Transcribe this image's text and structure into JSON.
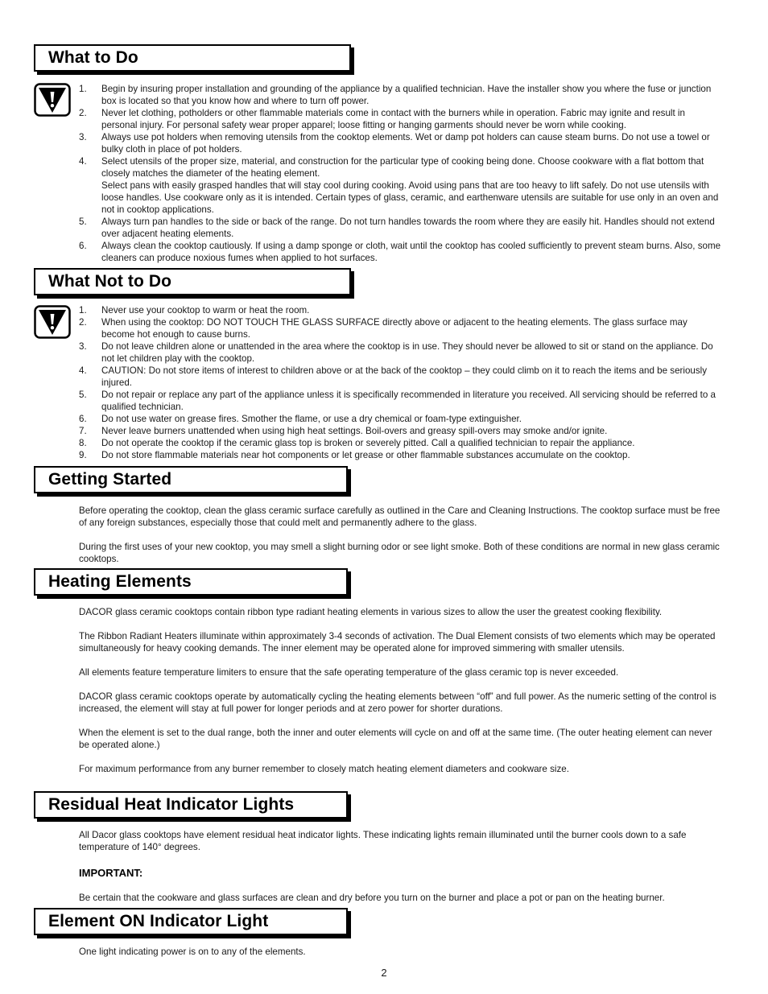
{
  "sections": {
    "what_to_do": {
      "title": "What to Do",
      "icon": "warning-icon",
      "items": [
        {
          "num": "1.",
          "text": "Begin by insuring proper installation and grounding of the appliance by a qualified technician. Have the installer show you where the fuse or junction box is located so that you know how and where to turn off power."
        },
        {
          "num": "2.",
          "text": "Never let clothing, potholders or other flammable materials come in contact with the burners while in operation. Fabric may ignite and result in personal injury. For personal safety wear proper apparel; loose fitting or hanging garments should never be worn while cooking."
        },
        {
          "num": "3.",
          "text": "Always use pot holders when removing utensils from the cooktop elements. Wet or damp pot holders can cause steam burns. Do not use a towel or bulky cloth in place of pot holders."
        },
        {
          "num": "4.",
          "text": "Select utensils of the proper size, material, and construction for the particular type of cooking being done. Choose cookware with a flat bottom that closely matches the diameter of the heating element.",
          "text2": "Select pans with easily grasped handles that will stay cool during cooking. Avoid using pans that are too heavy to lift safely. Do not use utensils with loose handles. Use cookware only as it is intended. Certain types of glass, ceramic, and earthenware utensils are suitable for use only in an oven and not in cooktop applications."
        },
        {
          "num": "5.",
          "text": "Always turn pan handles to the side or back of the range. Do not turn handles towards the room where they are easily hit. Handles should not extend over adjacent heating elements."
        },
        {
          "num": "6.",
          "text": "Always clean the cooktop cautiously. If using a damp sponge or cloth, wait until the cooktop has cooled sufficiently to prevent steam burns. Also, some cleaners can produce noxious fumes when applied to hot surfaces."
        }
      ]
    },
    "what_not_to_do": {
      "title": "What Not to Do",
      "icon": "warning-icon",
      "items": [
        {
          "num": "1.",
          "text": "Never use your cooktop to warm or heat the room."
        },
        {
          "num": "2.",
          "text": "When using the cooktop: DO NOT TOUCH THE GLASS SURFACE directly above or adjacent to the heating elements. The glass surface may become hot enough to cause burns."
        },
        {
          "num": "3.",
          "text": "Do not leave children alone or unattended in the area where the cooktop is in use. They should never be allowed to sit or stand on the appliance. Do not let children play with the cooktop."
        },
        {
          "num": "4.",
          "text": "CAUTION: Do not store items of interest to children above or at the back of the cooktop – they could climb on it to reach the items and be seriously injured."
        },
        {
          "num": "5.",
          "text": "Do not repair or replace any part of the appliance unless it is specifically recommended in literature you received. All servicing should be referred to a qualified technician."
        },
        {
          "num": "6.",
          "text": "Do not use water on grease fires. Smother the flame, or use a dry chemical or foam-type extinguisher."
        },
        {
          "num": "7.",
          "text": "Never leave burners unattended when using high heat settings. Boil-overs and greasy spill-overs may smoke and/or ignite."
        },
        {
          "num": "8.",
          "text": "Do not operate the cooktop if the ceramic glass top is broken or severely pitted. Call a qualified technician to repair the appliance."
        },
        {
          "num": "9.",
          "text": "Do not store flammable materials near hot components or let grease or other flammable substances accumulate on the cooktop."
        }
      ]
    },
    "getting_started": {
      "title": "Getting Started",
      "paragraphs": [
        "Before operating the cooktop, clean the glass ceramic surface carefully as outlined in the Care and Cleaning Instructions. The cooktop surface must be free of any foreign substances, especially those that could melt and permanently adhere to the glass.",
        "During the first uses of your new cooktop, you may smell a slight burning odor or see light smoke. Both of these conditions are normal in new glass ceramic cooktops."
      ]
    },
    "heating_elements": {
      "title": "Heating Elements",
      "paragraphs": [
        "DACOR glass ceramic cooktops contain ribbon type radiant heating elements in various sizes to allow the user the greatest cooking flexibility.",
        "The Ribbon Radiant Heaters illuminate within approximately 3-4 seconds of activation. The Dual Element consists of two elements which may be operated simultaneously for heavy cooking demands. The inner element may be operated alone for improved simmering with smaller utensils.",
        "All elements feature temperature limiters to ensure that the safe operating temperature of the glass ceramic top is never exceeded.",
        "DACOR glass ceramic cooktops operate by automatically cycling the heating elements between “off” and full power. As the numeric setting of the control is increased, the element will stay at full power for longer periods and at zero power for shorter durations.",
        "When the element is set to the dual range, both the inner and outer elements will cycle on and off at the same time. (The outer heating element can never be operated alone.)",
        "For maximum performance from any burner remember to closely match heating element diameters and cookware size."
      ]
    },
    "residual_heat": {
      "title": "Residual Heat Indicator Lights",
      "paragraph": "All Dacor glass cooktops have element residual heat indicator lights. These indicating lights remain illuminated until the burner cools down to a safe temperature of 140° degrees.",
      "important_label": "IMPORTANT:",
      "important_text": "Be certain that the cookware and glass surfaces are clean and dry before you turn on the burner and place a pot or pan on the heating burner."
    },
    "element_on": {
      "title": "Element ON Indicator Light",
      "paragraph": "One light indicating power is on to any of the elements."
    }
  },
  "page_number": "2"
}
